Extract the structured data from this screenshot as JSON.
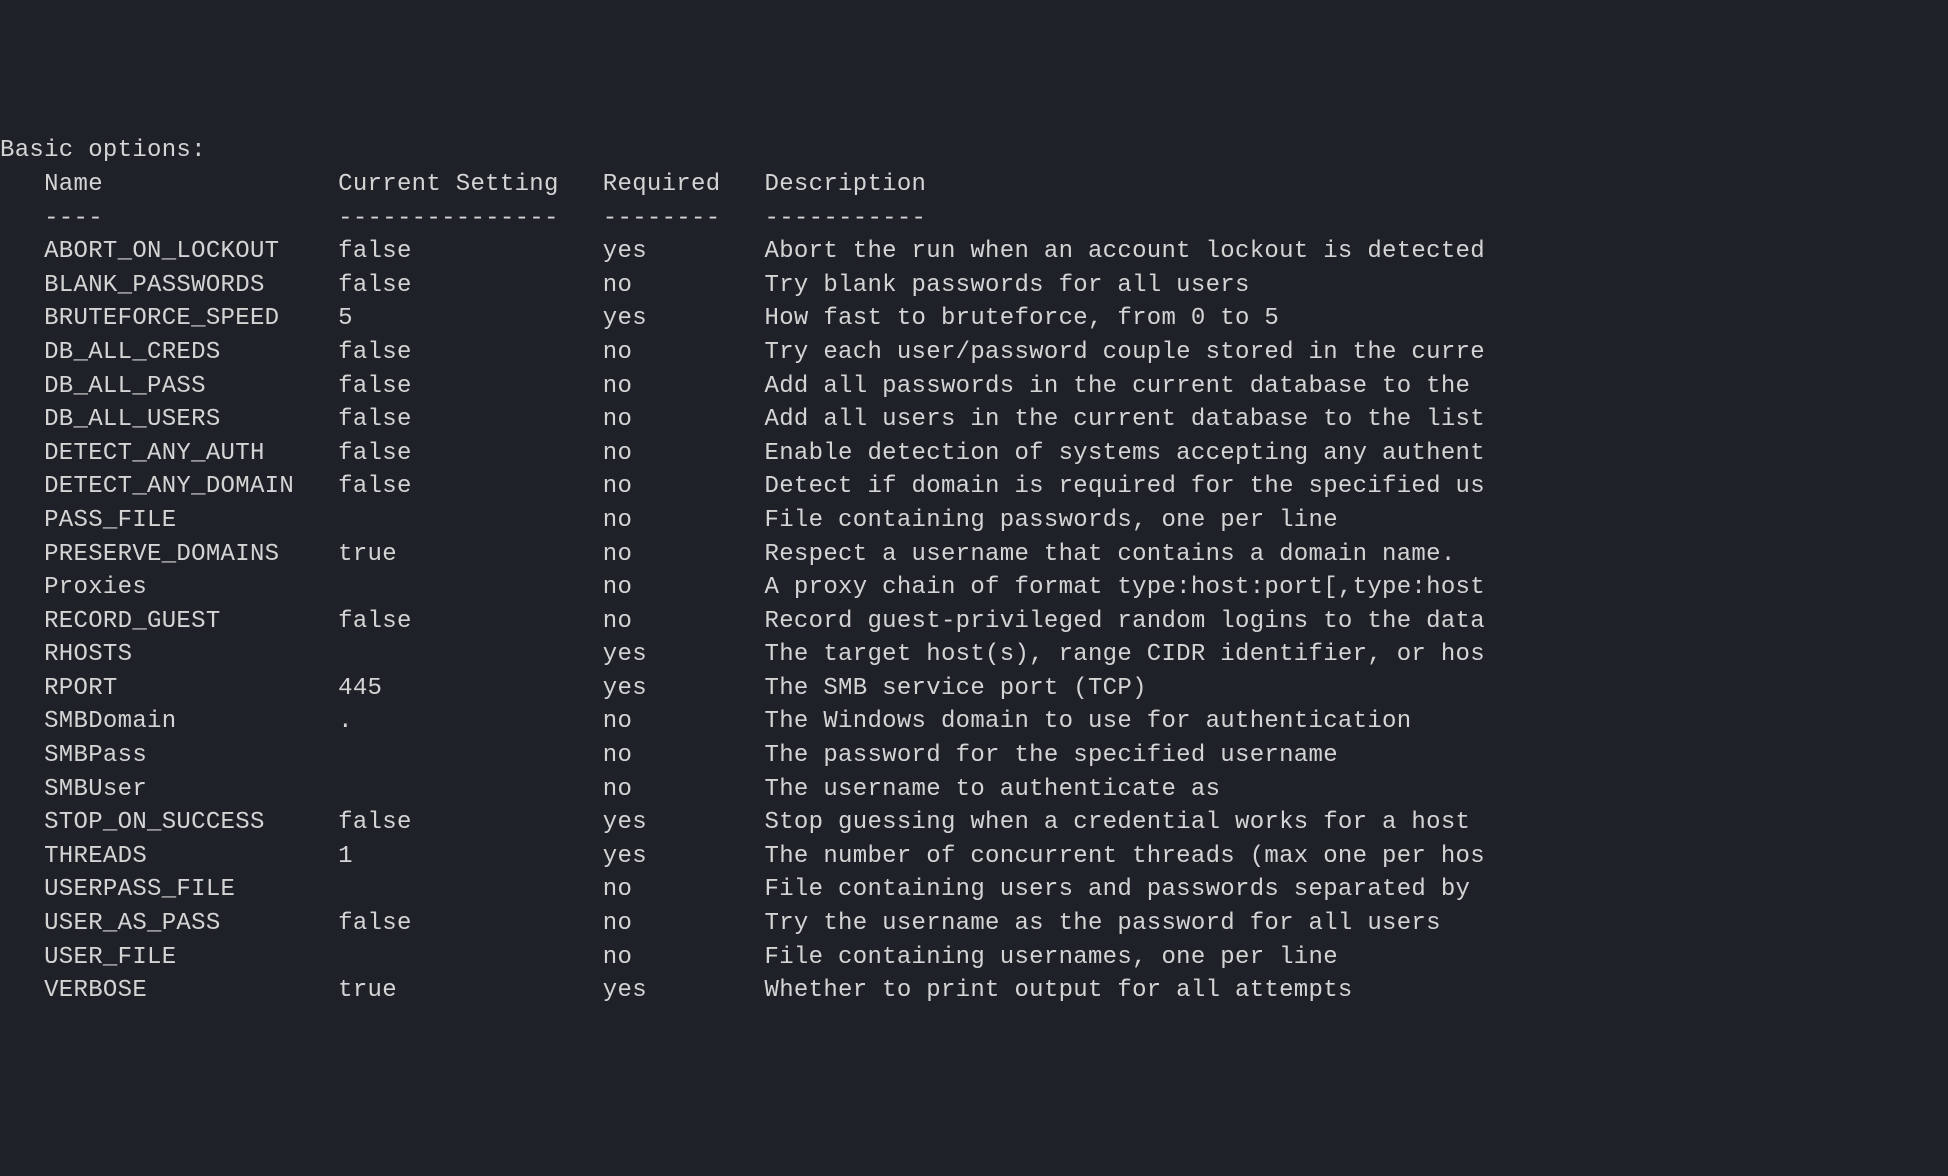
{
  "title": "Basic options:",
  "headers": {
    "name": "Name",
    "current_setting": "Current Setting",
    "required": "Required",
    "description": "Description"
  },
  "separators": {
    "name": "----",
    "current_setting": "---------------",
    "required": "--------",
    "description": "-----------"
  },
  "options": [
    {
      "name": "ABORT_ON_LOCKOUT",
      "current_setting": "false",
      "required": "yes",
      "description": "Abort the run when an account lockout is detected"
    },
    {
      "name": "BLANK_PASSWORDS",
      "current_setting": "false",
      "required": "no",
      "description": "Try blank passwords for all users"
    },
    {
      "name": "BRUTEFORCE_SPEED",
      "current_setting": "5",
      "required": "yes",
      "description": "How fast to bruteforce, from 0 to 5"
    },
    {
      "name": "DB_ALL_CREDS",
      "current_setting": "false",
      "required": "no",
      "description": "Try each user/password couple stored in the curre"
    },
    {
      "name": "DB_ALL_PASS",
      "current_setting": "false",
      "required": "no",
      "description": "Add all passwords in the current database to the "
    },
    {
      "name": "DB_ALL_USERS",
      "current_setting": "false",
      "required": "no",
      "description": "Add all users in the current database to the list"
    },
    {
      "name": "DETECT_ANY_AUTH",
      "current_setting": "false",
      "required": "no",
      "description": "Enable detection of systems accepting any authent"
    },
    {
      "name": "DETECT_ANY_DOMAIN",
      "current_setting": "false",
      "required": "no",
      "description": "Detect if domain is required for the specified us"
    },
    {
      "name": "PASS_FILE",
      "current_setting": "",
      "required": "no",
      "description": "File containing passwords, one per line"
    },
    {
      "name": "PRESERVE_DOMAINS",
      "current_setting": "true",
      "required": "no",
      "description": "Respect a username that contains a domain name."
    },
    {
      "name": "Proxies",
      "current_setting": "",
      "required": "no",
      "description": "A proxy chain of format type:host:port[,type:host"
    },
    {
      "name": "RECORD_GUEST",
      "current_setting": "false",
      "required": "no",
      "description": "Record guest-privileged random logins to the data"
    },
    {
      "name": "RHOSTS",
      "current_setting": "",
      "required": "yes",
      "description": "The target host(s), range CIDR identifier, or hos"
    },
    {
      "name": "RPORT",
      "current_setting": "445",
      "required": "yes",
      "description": "The SMB service port (TCP)"
    },
    {
      "name": "SMBDomain",
      "current_setting": ".",
      "required": "no",
      "description": "The Windows domain to use for authentication"
    },
    {
      "name": "SMBPass",
      "current_setting": "",
      "required": "no",
      "description": "The password for the specified username"
    },
    {
      "name": "SMBUser",
      "current_setting": "",
      "required": "no",
      "description": "The username to authenticate as"
    },
    {
      "name": "STOP_ON_SUCCESS",
      "current_setting": "false",
      "required": "yes",
      "description": "Stop guessing when a credential works for a host"
    },
    {
      "name": "THREADS",
      "current_setting": "1",
      "required": "yes",
      "description": "The number of concurrent threads (max one per hos"
    },
    {
      "name": "USERPASS_FILE",
      "current_setting": "",
      "required": "no",
      "description": "File containing users and passwords separated by "
    },
    {
      "name": "USER_AS_PASS",
      "current_setting": "false",
      "required": "no",
      "description": "Try the username as the password for all users"
    },
    {
      "name": "USER_FILE",
      "current_setting": "",
      "required": "no",
      "description": "File containing usernames, one per line"
    },
    {
      "name": "VERBOSE",
      "current_setting": "true",
      "required": "yes",
      "description": "Whether to print output for all attempts"
    }
  ],
  "column_widths": {
    "name": 20,
    "current_setting": 18,
    "required": 11
  },
  "indent": "   "
}
